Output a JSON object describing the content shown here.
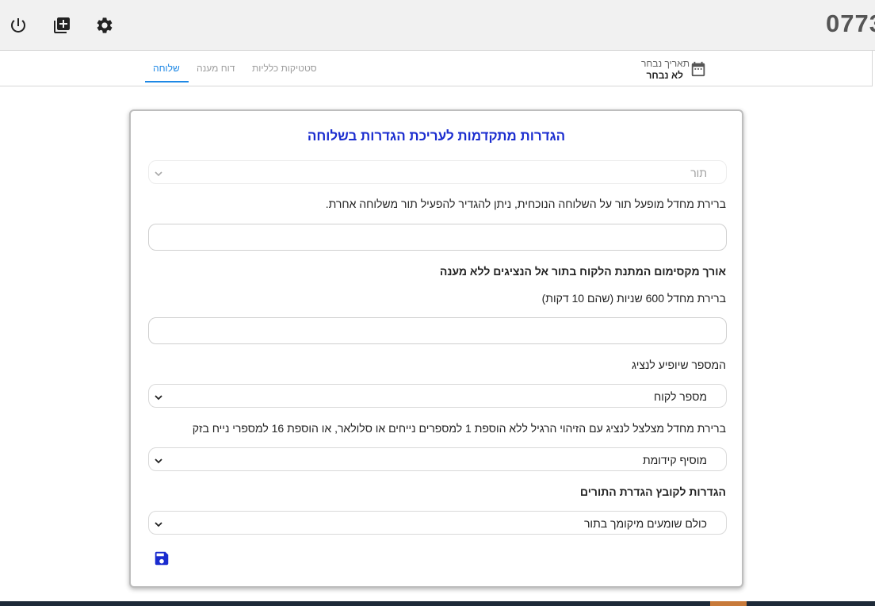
{
  "header": {
    "phone_number": "0773",
    "icons": [
      "power-icon",
      "library-books-icon",
      "gear-icon"
    ]
  },
  "subheader": {
    "tabs": [
      {
        "label": "שלוחה",
        "active": true
      },
      {
        "label": "דוח מענה",
        "active": false
      },
      {
        "label": "סטטיקות כלליות",
        "active": false
      }
    ],
    "date_picker": {
      "label": "תאריך נבחר",
      "value": "לא נבחר",
      "icon": "calendar-icon"
    }
  },
  "card": {
    "title": "הגדרות מתקדמות לעריכת הגדרות בשלוחה",
    "queue_select": {
      "value": "תור"
    },
    "queue_help": "ברירת מחדל מופעל תור על השלוחה הנוכחית, ניתן להגדיר להפעיל תור משלוחה אחרת.",
    "queue_input": {
      "value": ""
    },
    "max_wait_label": "אורך מקסימום המתנת הלקוח בתור אל הנציגים ללא מענה",
    "max_wait_help": "ברירת מחדל 600 שניות (שהם 10 דקות)",
    "max_wait_input": {
      "value": ""
    },
    "number_display_label": "המספר שיופיע לנציג",
    "number_display_select": {
      "value": "מספר לקוח"
    },
    "prefix_help": "ברירת מחדל מצלצל לנציג עם הזיהוי הרגיל ללא הוספת 1 למספרים נייחים או סלולאר, או הוספת 16 למספרי נייח בזק",
    "prefix_select": {
      "value": "מוסיף קידומת"
    },
    "queue_file_label": "הגדרות לקובץ הגדרת התורים",
    "queue_file_select": {
      "value": "כולם שומעים מיקומך בתור"
    },
    "save_icon": "save-icon"
  },
  "colors": {
    "accent": "#1e88e5",
    "title": "#1a2ccf",
    "save": "#1a2ccf"
  }
}
